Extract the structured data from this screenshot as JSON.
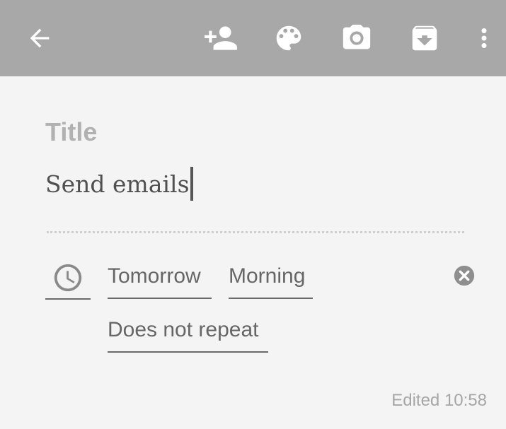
{
  "toolbar": {
    "back_icon": "arrow-back-icon",
    "collaborator_icon": "add-person-icon",
    "color_icon": "palette-icon",
    "camera_icon": "camera-icon",
    "archive_icon": "archive-icon",
    "more_icon": "more-vert-icon",
    "background_color": "#a8a8a8",
    "icon_color": "#ffffff"
  },
  "note": {
    "title_placeholder": "Title",
    "body_text": "Send emails"
  },
  "reminder": {
    "icon": "clock-icon",
    "date": "Tomorrow",
    "time": "Morning",
    "repeat": "Does not repeat",
    "clear_icon": "clear-circle-icon"
  },
  "footer": {
    "edited_text": "Edited 10:58"
  }
}
